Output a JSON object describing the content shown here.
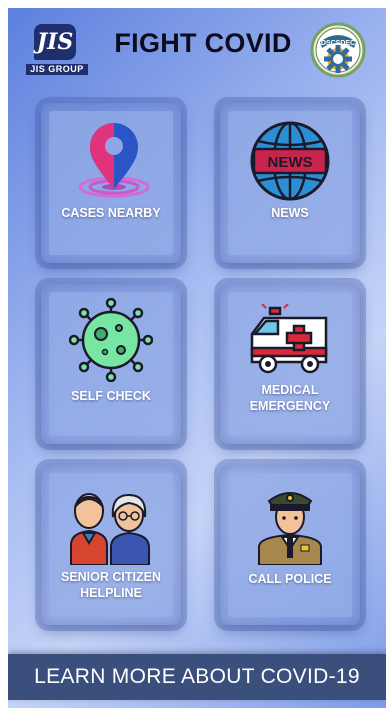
{
  "header": {
    "title": "FIGHT COVID",
    "left_logo": {
      "mark_text": "JIS",
      "caption": "JIS GROUP"
    },
    "right_logo": {
      "text": "DSCSDEC",
      "icon": "gear-seal-icon"
    }
  },
  "tiles": [
    {
      "label": "CASES NEARBY",
      "icon": "location-pin-icon"
    },
    {
      "label": "NEWS",
      "icon": "news-globe-icon",
      "badge": "NEWS"
    },
    {
      "label": "SELF CHECK",
      "icon": "virus-icon"
    },
    {
      "label": "MEDICAL\nEMERGENCY",
      "icon": "ambulance-icon"
    },
    {
      "label": "SENIOR CITIZEN\nHELPLINE",
      "icon": "elderly-couple-icon"
    },
    {
      "label": "CALL POLICE",
      "icon": "police-officer-icon"
    }
  ],
  "bottom_bar": {
    "label": "LEARN MORE ABOUT COVID-19"
  },
  "colors": {
    "title": "#0c0c1c",
    "bottom_bar": "#3a4f7c",
    "tile_label": "#ffffff"
  }
}
